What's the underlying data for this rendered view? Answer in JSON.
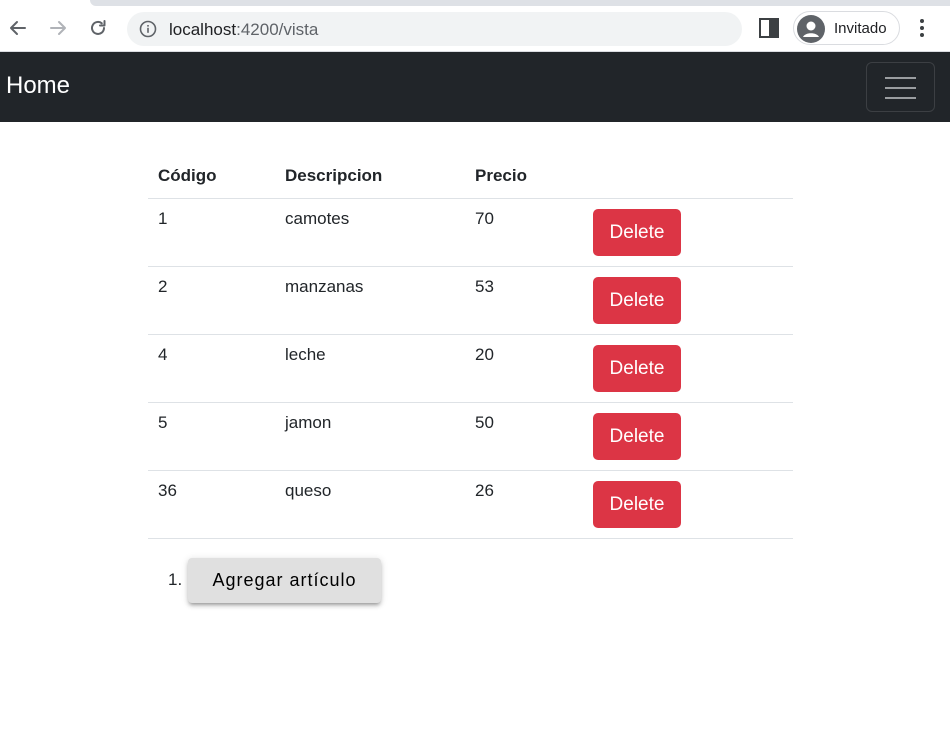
{
  "browser": {
    "url_host": "localhost",
    "url_path": ":4200/vista",
    "profile_label": "Invitado"
  },
  "navbar": {
    "brand": "Home"
  },
  "table": {
    "headers": [
      "Código",
      "Descripcion",
      "Precio",
      ""
    ],
    "rows": [
      {
        "codigo": "1",
        "descripcion": "camotes",
        "precio": "70",
        "action": "Delete"
      },
      {
        "codigo": "2",
        "descripcion": "manzanas",
        "precio": "53",
        "action": "Delete"
      },
      {
        "codigo": "4",
        "descripcion": "leche",
        "precio": "20",
        "action": "Delete"
      },
      {
        "codigo": "5",
        "descripcion": "jamon",
        "precio": "50",
        "action": "Delete"
      },
      {
        "codigo": "36",
        "descripcion": "queso",
        "precio": "26",
        "action": "Delete"
      }
    ]
  },
  "add_list": {
    "marker": "1.",
    "button_label": "Agregar artículo"
  },
  "colors": {
    "navbar_bg": "#212529",
    "delete_bg": "#dc3545",
    "add_button_bg": "#e0e0e0"
  },
  "icons": [
    "back-arrow-icon",
    "forward-arrow-icon",
    "reload-icon",
    "info-icon",
    "side-panel-icon",
    "profile-avatar-icon",
    "kebab-menu-icon",
    "hamburger-menu-icon"
  ]
}
